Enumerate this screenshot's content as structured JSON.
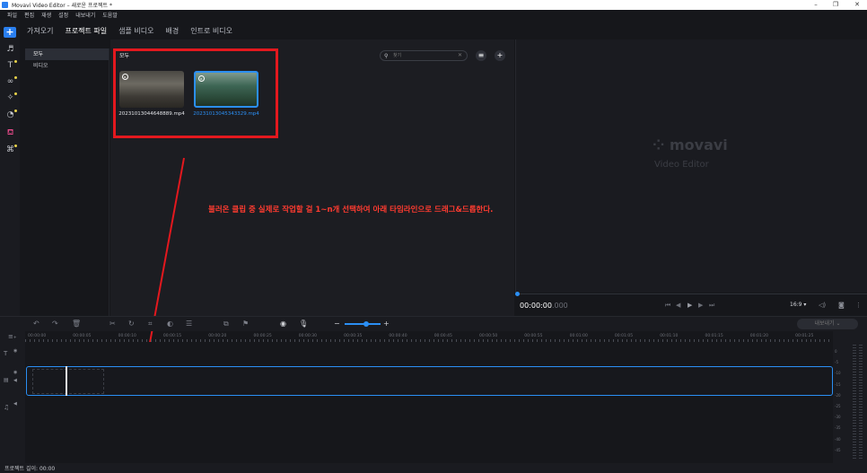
{
  "window": {
    "title": "Movavi Video Editor – 새로운 프로젝트 *",
    "controls": [
      "–",
      "❐",
      "✕"
    ]
  },
  "menu": [
    "파일",
    "편집",
    "재생",
    "설정",
    "내보내기",
    "도움말"
  ],
  "tabs": [
    "가져오기",
    "프로젝트 파일",
    "샘플 비디오",
    "배경",
    "인트로 비디오"
  ],
  "side": {
    "items": [
      "모두",
      "비디오"
    ]
  },
  "library": {
    "header": "모두",
    "search_placeholder": "찾기",
    "clips": [
      "20231013044648889.mp4",
      "20231013045343329.mp4"
    ]
  },
  "annotation": "불러온 클립 중 실제로 작업할 걸 1~n개 선택하여 아래 타임라인으로 드래그&드롭한다.",
  "preview": {
    "brand": "movavi",
    "brand_sub": "Video Editor",
    "timecode": "00:00:00",
    "timecode_ms": ".000",
    "aspect": "16:9 ▾"
  },
  "toolbar": {
    "export_label": "내보내기"
  },
  "ruler": [
    "00:00:00",
    "00:00:05",
    "00:00:10",
    "00:00:15",
    "00:00:20",
    "00:00:25",
    "00:00:30",
    "00:00:35",
    "00:00:40",
    "00:00:45",
    "00:00:50",
    "00:00:55",
    "00:01:00",
    "00:01:05",
    "00:01:10",
    "00:01:15",
    "00:01:20",
    "00:01:25"
  ],
  "vu_labels": [
    "0",
    "-5",
    "-10",
    "-15",
    "-20",
    "-25",
    "-30",
    "-35",
    "-40",
    "-45"
  ],
  "status": "프로젝트 길이: 00:00",
  "colors": {
    "accent": "#2b8ff4",
    "annotation": "#ff3b30",
    "box": "#e3181e"
  }
}
